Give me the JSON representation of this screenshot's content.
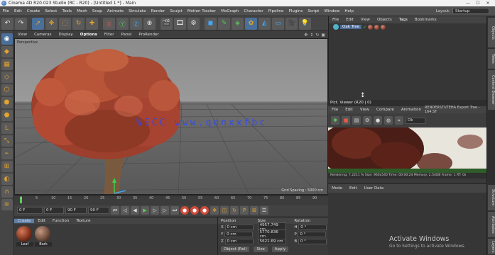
{
  "window": {
    "title": "Cinema 4D R20.023 Studio (RC - R20) - [Untitled 1 *] - Main",
    "min": "—",
    "max": "☐",
    "close": "✕"
  },
  "menu": {
    "items": [
      "File",
      "Edit",
      "Create",
      "Select",
      "Tools",
      "Mesh",
      "Snap",
      "Animate",
      "Simulate",
      "Render",
      "Sculpt",
      "Motion Tracker",
      "MoGraph",
      "Character",
      "Pipeline",
      "Plugins",
      "Script",
      "Window",
      "Help"
    ],
    "layout_label": "Layout:",
    "layout_value": "Startup"
  },
  "viewport": {
    "menu": [
      "View",
      "Cameras",
      "Display",
      "Options",
      "Filter",
      "Panel",
      "ProRender"
    ],
    "active_menu": "Options",
    "label": "Perspective",
    "grid_spacing": "Grid Spacing : 5000 cm"
  },
  "timeline": {
    "ticks": [
      "0",
      "5",
      "10",
      "15",
      "20",
      "25",
      "30",
      "35",
      "40",
      "45",
      "50",
      "55",
      "60",
      "65",
      "70",
      "75",
      "80",
      "85",
      "90"
    ]
  },
  "playback": {
    "start": "0 F",
    "current": "0 F",
    "end": "90 F",
    "end2": "90 F"
  },
  "materials": {
    "menu": [
      "Create",
      "Edit",
      "Function",
      "Texture"
    ],
    "active": "Create",
    "items": [
      {
        "name": "Leaf"
      },
      {
        "name": "Bark"
      }
    ]
  },
  "coordinates": {
    "headers": [
      "Position",
      "Size",
      "Rotation"
    ],
    "rows": [
      {
        "axis": "X",
        "pos": "0 cm",
        "size": "4957.749 cm",
        "rot_label": "H",
        "rot": "0 °"
      },
      {
        "axis": "Y",
        "pos": "0 cm",
        "size": "5770.836 cm",
        "rot_label": "P",
        "rot": "0 °"
      },
      {
        "axis": "Z",
        "pos": "0 cm",
        "size": "5621.69 cm",
        "rot_label": "B",
        "rot": "0 °"
      }
    ],
    "mode": "Object (Rel)",
    "size_mode": "Size",
    "apply": "Apply"
  },
  "objects": {
    "tabs": [
      "File",
      "Edit",
      "View",
      "Objects",
      "Tags",
      "Bookmarks"
    ],
    "active_tab": "Tags",
    "items": [
      {
        "name": "Oak Tree"
      }
    ]
  },
  "picture_viewer": {
    "title": "Pict. Viewer (R20 | 0)",
    "menu": [
      "File",
      "Edit",
      "View",
      "Compare",
      "Animation"
    ],
    "file": "RENDERSTUTEHA Export Tree - 164.ST",
    "progress": "Progress: 1 Sequence Sequence 1",
    "zoom": "Ok",
    "status": "Rendering: 7.2211 %     Size: 960x540     Time: 00:00:24     Memory: 2.54GB     Frame: 1     RT: 0s"
  },
  "attributes": {
    "menu": [
      "Mode",
      "Edit",
      "User Data"
    ]
  },
  "side_tabs": [
    "Objects",
    "Takes",
    "Content Browser",
    "Structure",
    "Attributes",
    "Layers"
  ],
  "watermark": "WECC www.qdnxxfbc",
  "activate": {
    "line1": "Activate Windows",
    "line2": "Go to Settings to activate Windows."
  },
  "colors": {
    "accent_blue": "#4b6b97",
    "accent_orange": "#e5a42d",
    "play_green": "#5ccc5a"
  }
}
